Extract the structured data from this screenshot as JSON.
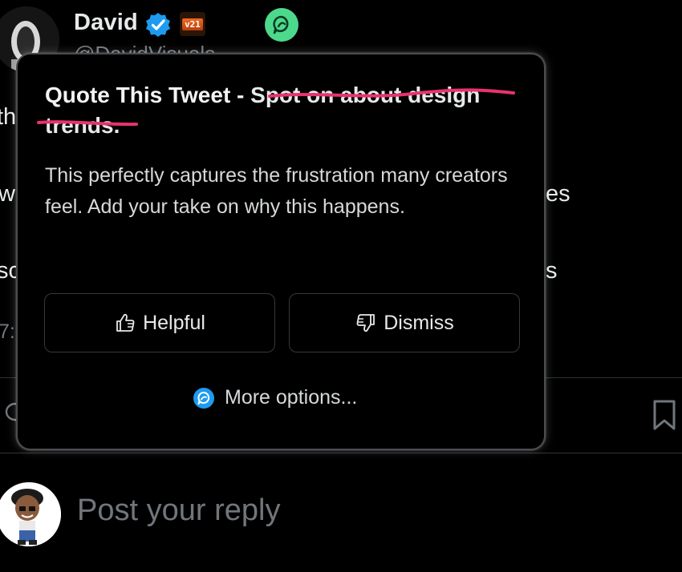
{
  "tweet": {
    "author_name": "David",
    "handle": "@DavidVisuals",
    "affiliate_badge_text": "v21",
    "text_fragments": {
      "line1_left": "th",
      "line2_left": "w",
      "line2_right": "es",
      "line3_left": "sc",
      "line3_right": "s",
      "time_fragment": "7:"
    }
  },
  "popup": {
    "title_prefix": "Quote This Tweet - ",
    "title_struck": "Spot on about design trends.",
    "body": "This perfectly captures the frustration many creators feel. Add your take on why this happens.",
    "helpful_label": "Helpful",
    "dismiss_label": "Dismiss",
    "more_options_label": "More options..."
  },
  "reply": {
    "placeholder": "Post your reply"
  },
  "colors": {
    "background": "#000000",
    "verified_blue": "#1d9bf0",
    "grok_green": "#4cd98c",
    "strike_pink": "#e8336d",
    "muted_text": "#71767b"
  },
  "icons": [
    "verified-badge-icon",
    "grok-icon",
    "thumbs-up-icon",
    "thumbs-down-icon",
    "grok-small-icon",
    "reply-icon",
    "bookmark-icon"
  ]
}
